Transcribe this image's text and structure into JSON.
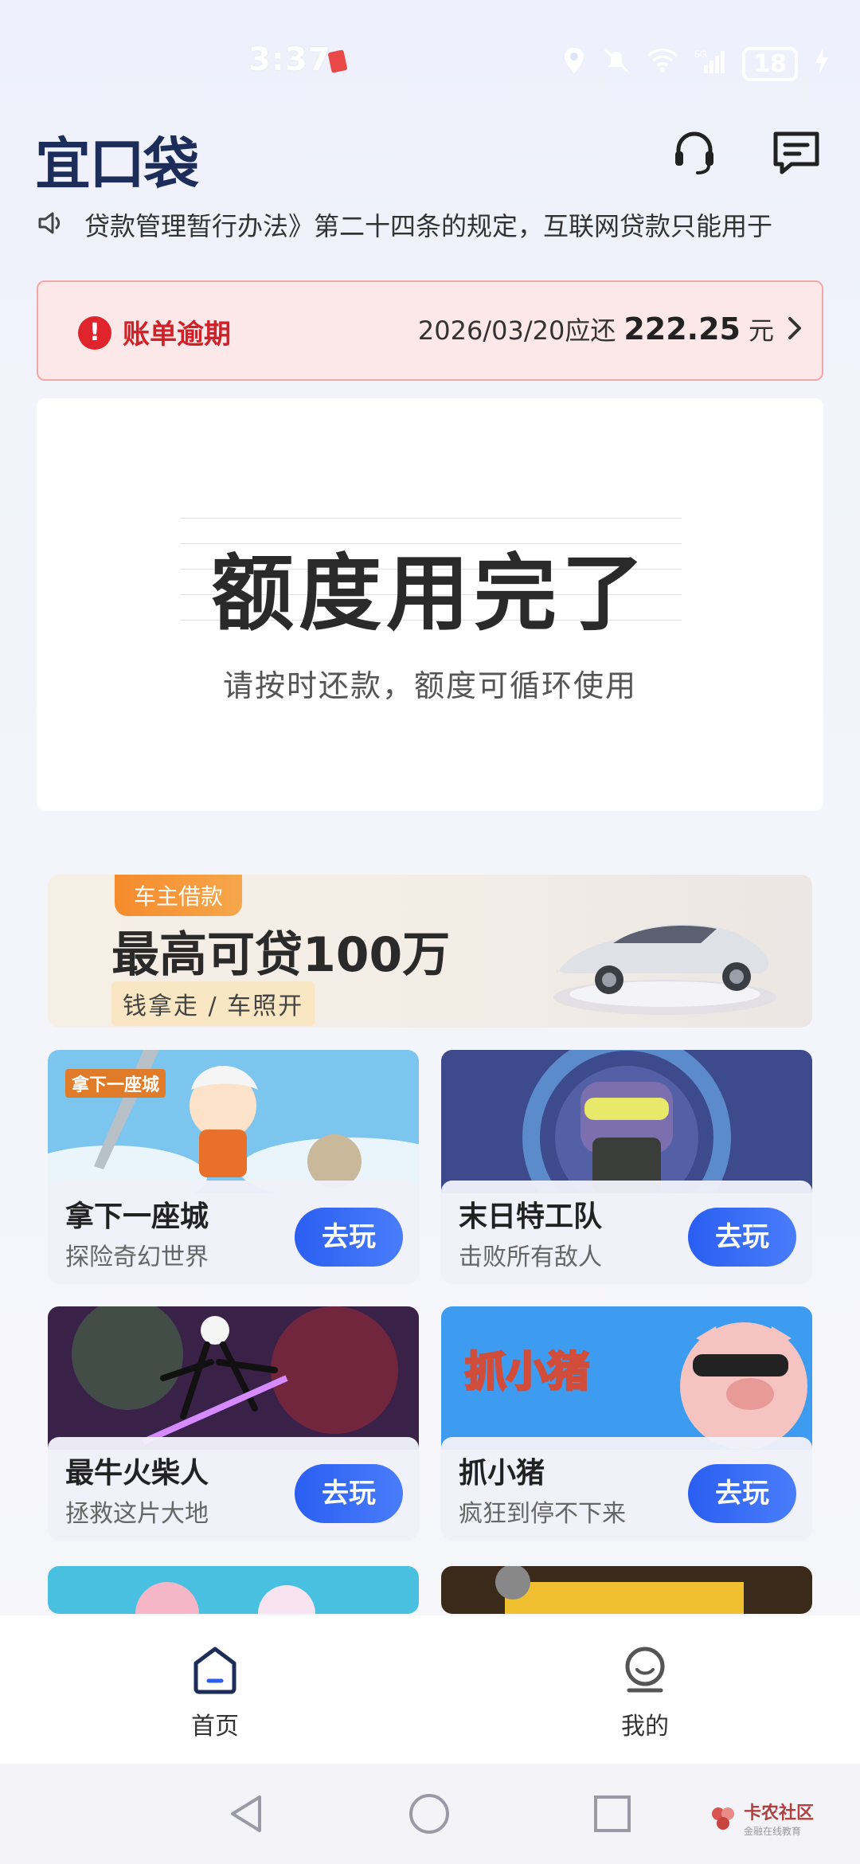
{
  "status_bar": {
    "time": "3:37",
    "battery": "18",
    "network": "5G"
  },
  "header": {
    "logo_text": "宜口袋"
  },
  "notice": {
    "text": "贷款管理暂行办法》第二十四条的规定，互联网贷款只能用于"
  },
  "overdue": {
    "title": "账单逾期",
    "due_text": "2026/03/20应还",
    "amount": "222.25",
    "unit": "元"
  },
  "credit": {
    "title": "额度用完了",
    "subtitle": "请按时还款，额度可循环使用"
  },
  "banner": {
    "tag": "车主借款",
    "title": "最高可贷100万",
    "subtitle": "钱拿走 / 车照开"
  },
  "games": [
    {
      "name": "拿下一座城",
      "desc": "探险奇幻世界",
      "button": "去玩",
      "art_label": "拿下一座城"
    },
    {
      "name": "末日特工队",
      "desc": "击败所有敌人",
      "button": "去玩"
    },
    {
      "name": "最牛火柴人",
      "desc": "拯救这片大地",
      "button": "去玩"
    },
    {
      "name": "抓小猪",
      "desc": "疯狂到停不下来",
      "button": "去玩",
      "art_label": "抓小猪"
    }
  ],
  "bottom_nav": [
    {
      "label": "首页",
      "icon": "home-icon",
      "active": true
    },
    {
      "label": "我的",
      "icon": "profile-icon",
      "active": false
    }
  ],
  "watermark": {
    "title": "卡农社区",
    "subtitle": "金融在线教育"
  },
  "colors": {
    "accent": "#2a5ef1",
    "alert": "#d12128",
    "logo": "#1d2d5a"
  }
}
